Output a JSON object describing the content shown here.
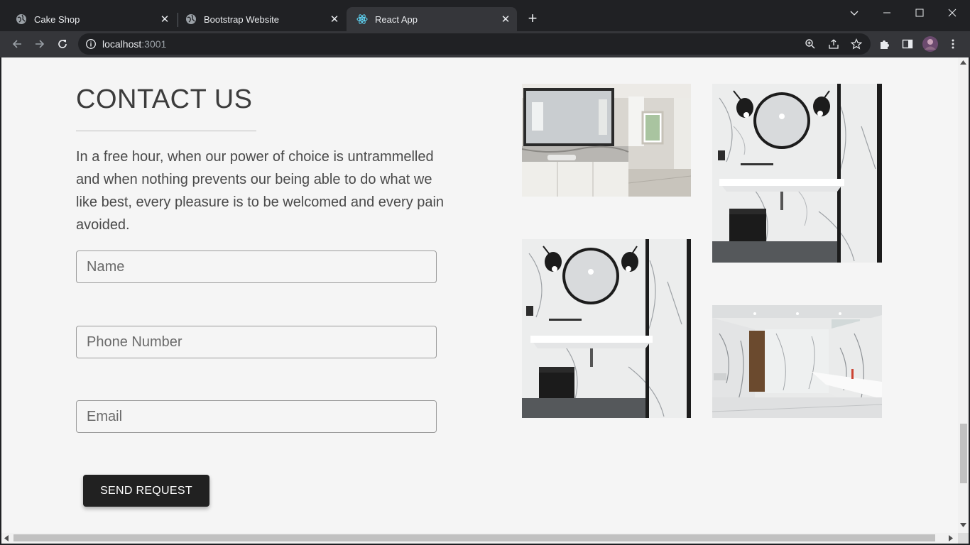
{
  "browser": {
    "tabs": [
      {
        "title": "Cake Shop",
        "icon": "globe-icon"
      },
      {
        "title": "Bootstrap Website",
        "icon": "globe-icon"
      },
      {
        "title": "React App",
        "icon": "react-icon",
        "active": true
      }
    ],
    "address": {
      "host": "localhost",
      "port": ":3001"
    }
  },
  "contact": {
    "title": "CONTACT US",
    "intro": "In a free hour, when our power of choice is untrammelled and when nothing prevents our being able to do what we like best, every pleasure is to be welcomed and every pain avoided.",
    "fields": {
      "name_placeholder": "Name",
      "phone_placeholder": "Phone Number",
      "email_placeholder": "Email"
    },
    "submit_label": "SEND REQUEST"
  },
  "gallery": [
    {
      "subject": "bathroom-vanity-photo"
    },
    {
      "subject": "round-mirror-marble-bathroom-photo"
    },
    {
      "subject": "round-mirror-marble-bathroom-photo"
    },
    {
      "subject": "marble-bathroom-interior-photo"
    }
  ],
  "colors": {
    "page_bg": "#f5f5f5",
    "button_bg": "#212121",
    "chrome_dark": "#202124",
    "chrome_toolbar": "#35363a"
  }
}
